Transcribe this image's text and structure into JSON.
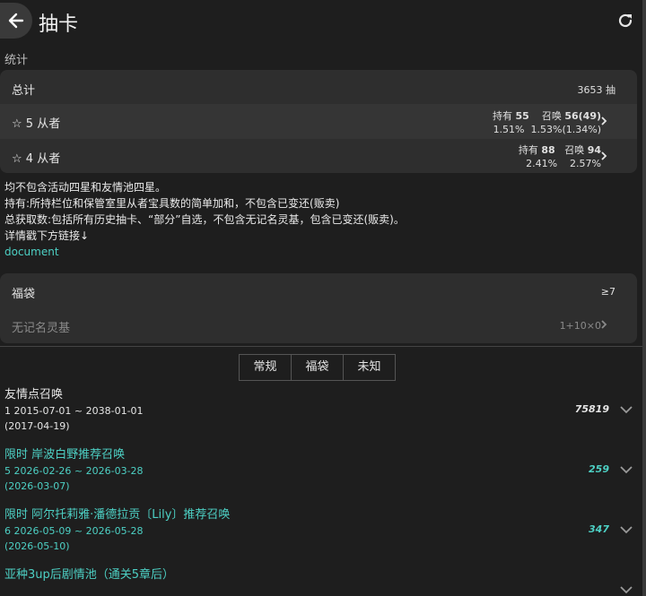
{
  "header": {
    "title": "抽卡",
    "back_icon": "arrow-left-icon",
    "refresh_icon": "refresh-icon"
  },
  "stats": {
    "section_label": "统计",
    "total": {
      "label": "总计",
      "value": "3653 抽"
    },
    "five_star": {
      "label": "☆ 5 从者",
      "own_label": "持有",
      "own_value": "55",
      "summon_label": "召唤",
      "summon_value": "56(49)",
      "own_pct": "1.51%",
      "summon_pct": "1.53%(1.34%)"
    },
    "four_star": {
      "label": "☆ 4 从者",
      "own_label": "持有",
      "own_value": "88",
      "summon_label": "召唤",
      "summon_value": "94",
      "own_pct": "2.41%",
      "summon_pct": "2.57%"
    }
  },
  "notes": {
    "line1": "均不包含活动四星和友情池四星。",
    "line2": "持有:所持栏位和保管室里从者宝具数的简单加和，不包含已变还(贩卖)",
    "line3": "总获取数:包括所有历史抽卡、“部分”自选，不包含无记名灵基，包含已变还(贩卖)。",
    "line4": "详情戳下方链接↓",
    "link": "document"
  },
  "lucky": {
    "label": "福袋",
    "value": "≥7",
    "saint_label": "无记名灵基",
    "saint_value": "1+10×0"
  },
  "tabs": [
    "常规",
    "福袋",
    "未知"
  ],
  "pools": [
    {
      "title": "友情点召唤",
      "line2": "1   2015-07-01 ~ 2038-01-01",
      "line3": "(2017-04-19)",
      "count": "75819",
      "teal": false
    },
    {
      "title": "限时 岸波白野推荐召唤",
      "line2": "5   2026-02-26 ~ 2026-03-28",
      "line3": "(2026-03-07)",
      "count": "259",
      "teal": true
    },
    {
      "title": "限时 阿尔托莉雅·潘德拉贡〔Lily〕推荐召唤",
      "line2": "6   2026-05-09 ~ 2026-05-28",
      "line3": "(2026-05-10)",
      "count": "347",
      "teal": true
    },
    {
      "title": "亚种3up后剧情池（通关5章后）",
      "line2": "",
      "line3": "",
      "count": "",
      "teal": true
    }
  ]
}
